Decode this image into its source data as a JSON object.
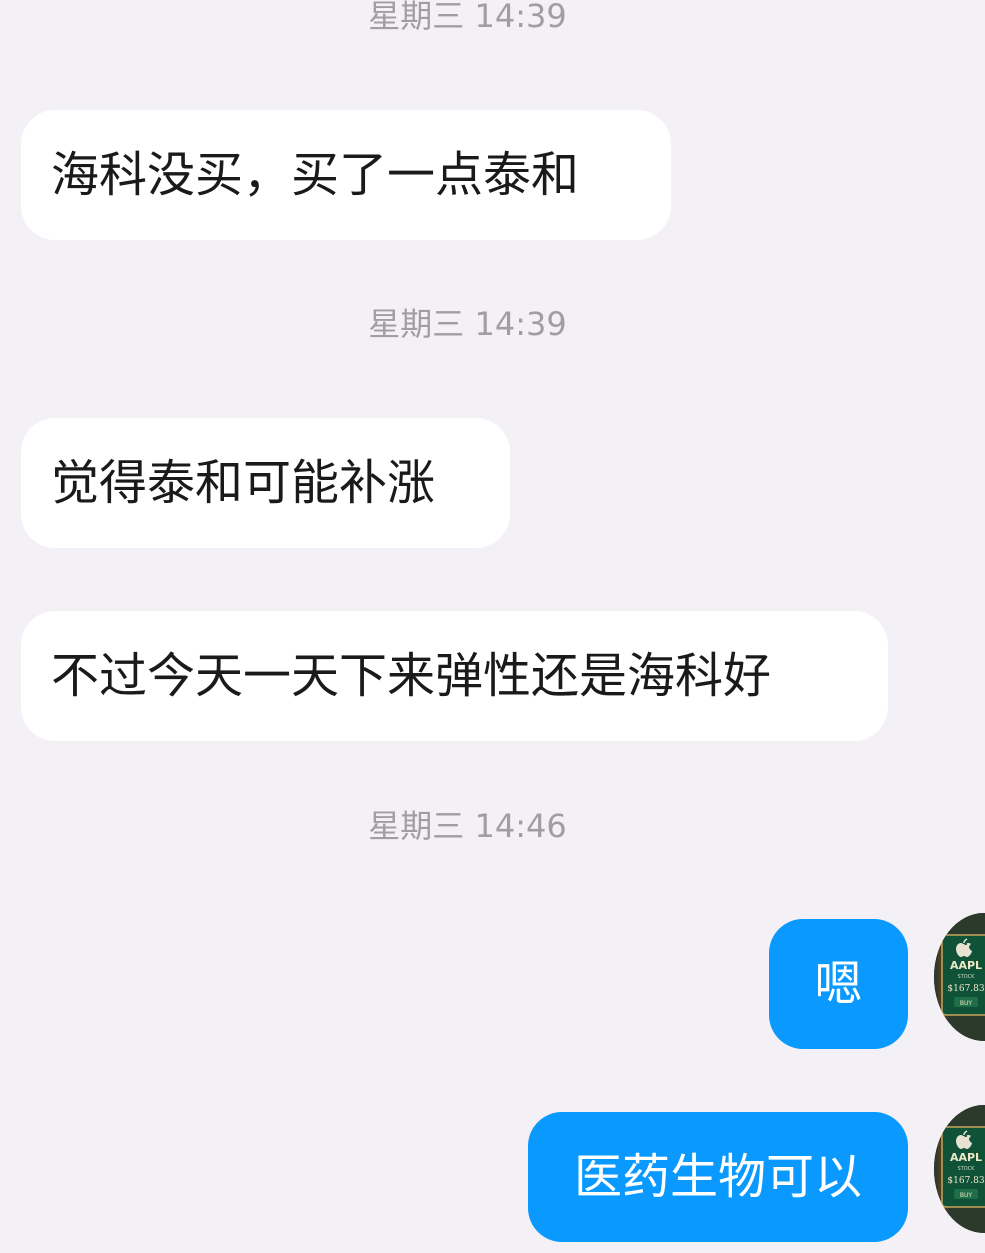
{
  "timestamps": [
    "星期三 14:39",
    "星期三 14:39",
    "星期三 14:46"
  ],
  "messages": [
    {
      "side": "in",
      "text": "海科没买，买了一点泰和"
    },
    {
      "side": "in",
      "text": "觉得泰和可能补涨"
    },
    {
      "side": "in",
      "text": "不过今天一天下来弹性还是海科好"
    },
    {
      "side": "out",
      "text": "嗯"
    },
    {
      "side": "out",
      "text": "医药生物可以"
    }
  ],
  "avatar": {
    "ticker": "AAPL",
    "label": "STOCK",
    "price": "$167.83",
    "action": "BUY"
  },
  "colors": {
    "background": "#f4f1f6",
    "incoming_bubble": "#ffffff",
    "outgoing_bubble": "#0a99ff",
    "timestamp": "#a09ea3"
  }
}
